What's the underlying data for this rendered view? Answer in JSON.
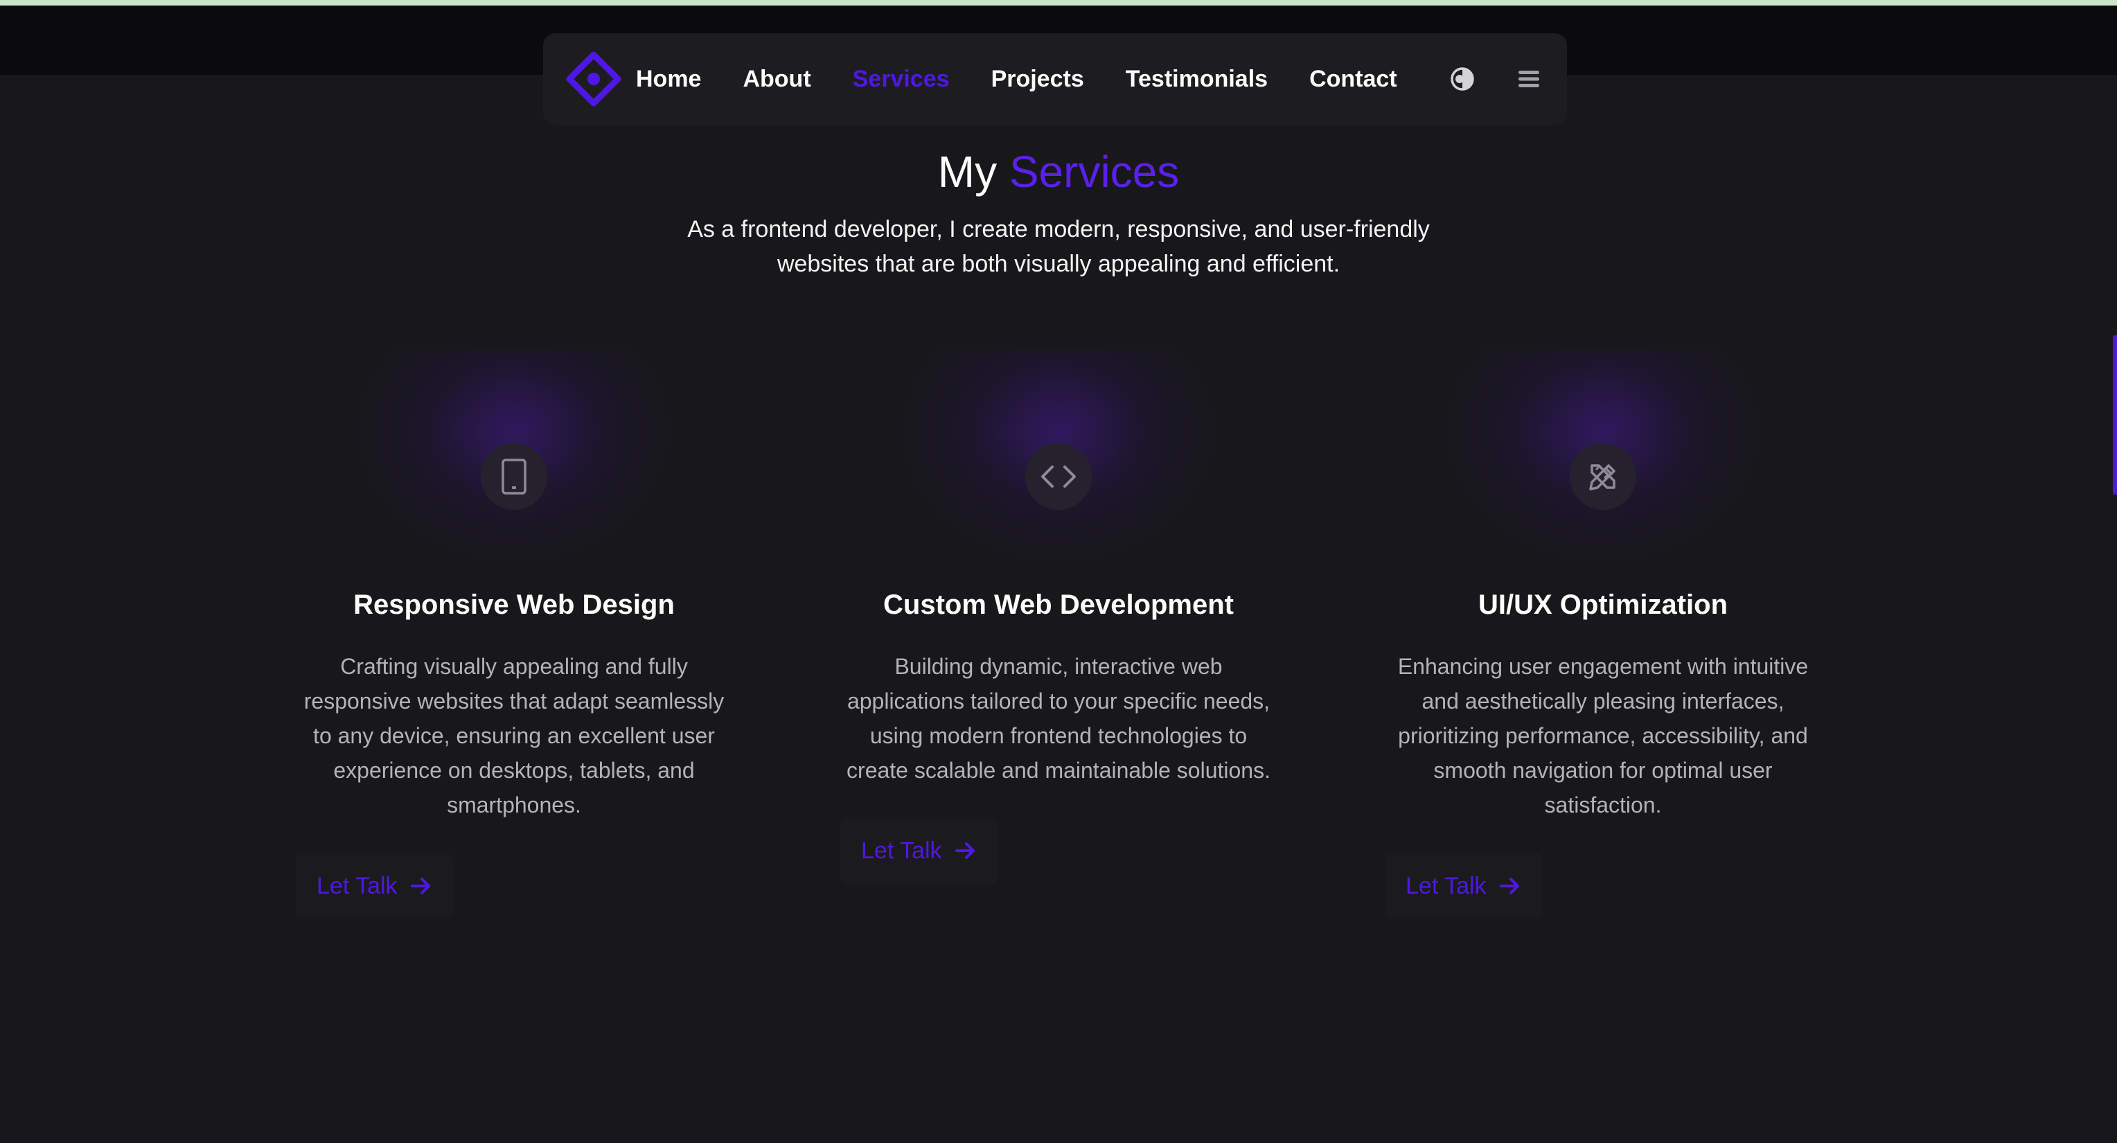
{
  "nav": {
    "logo_icon": "diamond-logo-icon",
    "links": [
      {
        "label": "Home",
        "active": false
      },
      {
        "label": "About",
        "active": false
      },
      {
        "label": "Services",
        "active": true
      },
      {
        "label": "Projects",
        "active": false
      },
      {
        "label": "Testimonials",
        "active": false
      },
      {
        "label": "Contact",
        "active": false
      }
    ],
    "theme_toggle_icon": "contrast-icon",
    "menu_icon": "hamburger-icon"
  },
  "section": {
    "heading_prefix": "My",
    "heading_accent": "Services",
    "subtitle": "As a frontend developer, I create modern, responsive, and user-friendly websites that are both visually appealing and efficient."
  },
  "services": [
    {
      "icon": "tablet-icon",
      "title": "Responsive Web Design",
      "description": "Crafting visually appealing and fully responsive websites that adapt seamlessly to any device, ensuring an excellent user experience on desktops, tablets, and smartphones.",
      "cta": "Let Talk"
    },
    {
      "icon": "code-icon",
      "title": "Custom Web Development",
      "description": "Building dynamic, interactive web applications tailored to your specific needs, using modern frontend technologies to create scalable and maintainable solutions.",
      "cta": "Let Talk"
    },
    {
      "icon": "design-tools-icon",
      "title": "UI/UX Optimization",
      "description": "Enhancing user engagement with intuitive and aesthetically pleasing interfaces, prioritizing performance, accessibility, and smooth navigation for optimal user satisfaction.",
      "cta": "Let Talk"
    }
  ],
  "colors": {
    "accent": "#4f17e6",
    "background": "#18181b",
    "card_text": "#b3b3b8"
  }
}
